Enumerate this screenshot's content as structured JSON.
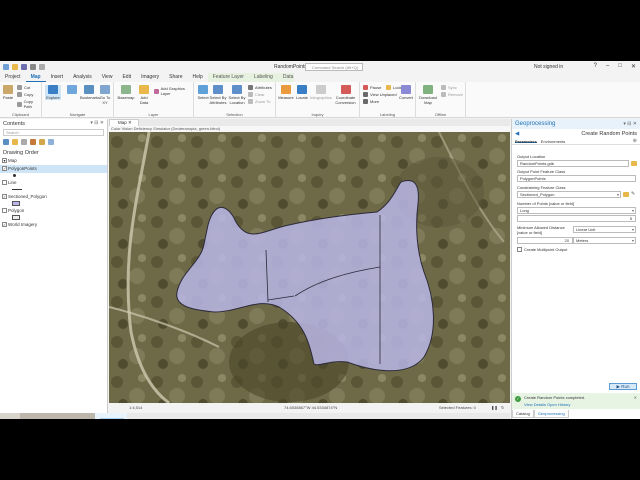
{
  "app": {
    "title": "RandomPoints",
    "command_search_placeholder": "Command Search (Alt+Q)",
    "signin": "Not signed in"
  },
  "ribbon_tabs": [
    "Project",
    "Map",
    "Insert",
    "Analysis",
    "View",
    "Edit",
    "Imagery",
    "Share",
    "Help",
    "Feature Layer",
    "Labeling",
    "Data"
  ],
  "ribbon": {
    "clipboard": {
      "label": "Clipboard",
      "paste": "Paste",
      "cut": "Cut",
      "copy": "Copy",
      "copy_path": "Copy Path"
    },
    "navigate": {
      "label": "Navigate",
      "explore": "Explore",
      "bookmarks": "Bookmarks",
      "go_to_xy": "Go To XY"
    },
    "layer": {
      "label": "Layer",
      "basemap": "Basemap",
      "add_data": "Add Data",
      "add_graphics": "Add Graphics Layer"
    },
    "selection": {
      "label": "Selection",
      "select": "Select",
      "select_by_attributes": "Select By Attributes",
      "select_by_location": "Select By Location",
      "attributes": "Attributes",
      "clear": "Clear",
      "zoom_to": "Zoom To"
    },
    "inquiry": {
      "label": "Inquiry",
      "measure": "Measure",
      "locate": "Locate",
      "infographics": "Infographics",
      "coordinate_conversion": "Coordinate Conversion"
    },
    "labeling": {
      "label": "Labeling",
      "pause": "Pause",
      "lock": "Lock",
      "view_unplaced": "View Unplaced",
      "more": "More",
      "convert": "Convert"
    },
    "offline": {
      "label": "Offline",
      "download_map": "Download Map",
      "sync": "Sync",
      "remove": "Remove"
    }
  },
  "contents": {
    "title": "Contents",
    "search_placeholder": "Search",
    "section": "Drawing Order",
    "items": [
      {
        "label": "Map",
        "checked": true,
        "selected": false
      },
      {
        "label": "PolygonPoints",
        "checked": true,
        "selected": true
      },
      {
        "label": "Line",
        "checked": false,
        "selected": false
      },
      {
        "label": "Sectioned_Polygon",
        "checked": true,
        "selected": false
      },
      {
        "label": "Polygon",
        "checked": false,
        "selected": false
      },
      {
        "label": "World Imagery",
        "checked": true,
        "selected": false
      }
    ]
  },
  "map": {
    "tab": "Map",
    "banner": "Color Vision Deficiency Simulator (Deuteranopia, green-blind)",
    "scale": "1:4,514",
    "coords": "74.6538867°W 44.5334874°N",
    "selected_features": "Selected Features: 0"
  },
  "geoprocessing": {
    "title": "Geoprocessing",
    "tool": "Create Random Points",
    "tabs": [
      "Parameters",
      "Environments"
    ],
    "params": [
      {
        "label": "Output Location",
        "value": "RandomPoints.gdb"
      },
      {
        "label": "Output Point Feature Class",
        "value": "PolygonPoints"
      },
      {
        "label": "Constraining Feature Class",
        "value": "Sectioned_Polygon"
      },
      {
        "label": "Number of Points [value or field]",
        "value": "Long",
        "value2": "5"
      },
      {
        "label": "Minimum Allowed Distance [value or field]",
        "value": "Linear Unit",
        "value2": "20",
        "unit": "Meters"
      }
    ],
    "multipoint_label": "Create Multipoint Output",
    "run": "Run",
    "success_text": "Create Random Points completed.",
    "success_links": "View Details   Open History",
    "bottom_tabs": [
      "Catalog",
      "Geoprocessing"
    ]
  },
  "colors": {
    "accent": "#1e6fb8",
    "polygon_fill": "#b9b6e6",
    "polygon_stroke": "#2d2a3a"
  }
}
